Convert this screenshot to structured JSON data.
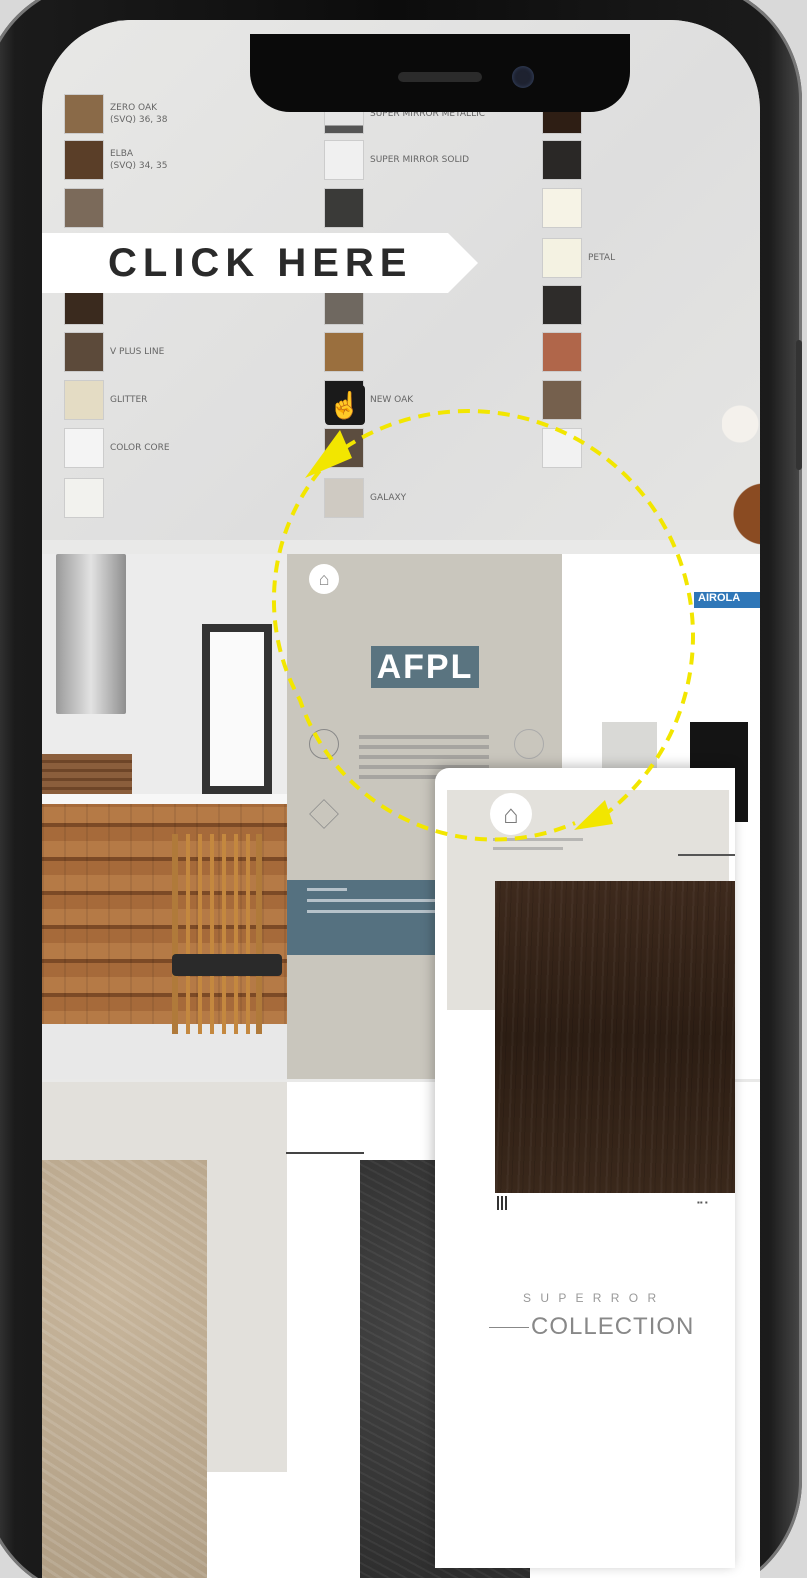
{
  "catalog": {
    "swatches": [
      {
        "name": "ZERO OAK",
        "code": "(SVQ) 36, 38"
      },
      {
        "name": "ELBA",
        "code": "(SVQ) 34, 35"
      },
      {
        "name": "",
        "code": ""
      },
      {
        "name": "",
        "code": ""
      },
      {
        "name": "",
        "code": ""
      },
      {
        "name": "V PLUS LINE",
        "code": ""
      },
      {
        "name": "GLITTER",
        "code": ""
      },
      {
        "name": "COLOR CORE",
        "code": ""
      },
      {
        "name": "",
        "code": ""
      },
      {
        "name": "SUPER MIRROR METALLIC",
        "code": ""
      },
      {
        "name": "SUPER MIRROR SOLID",
        "code": ""
      },
      {
        "name": "",
        "code": ""
      },
      {
        "name": "",
        "code": ""
      },
      {
        "name": "",
        "code": ""
      },
      {
        "name": "",
        "code": ""
      },
      {
        "name": "NEW OAK",
        "code": ""
      },
      {
        "name": "",
        "code": ""
      },
      {
        "name": "GALAXY",
        "code": ""
      },
      {
        "name": "",
        "code": ""
      },
      {
        "name": "",
        "code": ""
      },
      {
        "name": "",
        "code": ""
      },
      {
        "name": "PETAL",
        "code": ""
      },
      {
        "name": "",
        "code": ""
      },
      {
        "name": "",
        "code": ""
      },
      {
        "name": "",
        "code": ""
      },
      {
        "name": "",
        "code": ""
      }
    ],
    "click_here_label": "CLICK HERE"
  },
  "intro_page": {
    "logo_text": "AFPL"
  },
  "brand_page": {
    "logo_text": "AIROLA"
  },
  "card": {
    "collection_small": "S U P E R  R O R",
    "collection_big": "COLLECTION"
  },
  "colors": {
    "accent_yellow": "#f2e600",
    "teal": "#557180",
    "brand_blue": "#2f77b8"
  },
  "icons": [
    "home-icon",
    "touch-icon",
    "qr-icon"
  ]
}
